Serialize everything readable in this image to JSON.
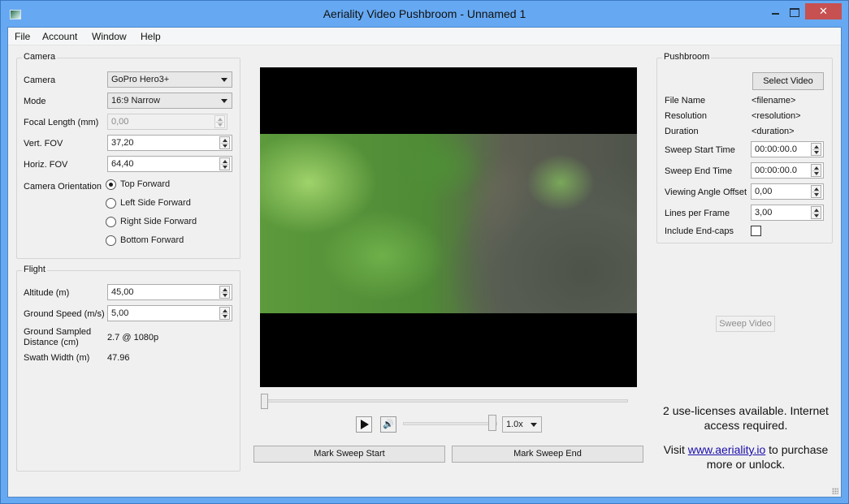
{
  "window": {
    "title": "Aeriality Video Pushbroom - Unnamed 1",
    "close_glyph": "✕",
    "icon": "app-icon"
  },
  "menu": [
    "File",
    "Account",
    "Window",
    "Help"
  ],
  "camera": {
    "group_title": "Camera",
    "camera_label": "Camera",
    "camera_value": "GoPro Hero3+",
    "mode_label": "Mode",
    "mode_value": "16:9 Narrow",
    "focal_label": "Focal Length (mm)",
    "focal_value": "0,00",
    "vfov_label": "Vert. FOV",
    "vfov_value": "37,20",
    "hfov_label": "Horiz. FOV",
    "hfov_value": "64,40",
    "orientation_label": "Camera Orientation",
    "orientations": [
      {
        "label": "Top Forward",
        "checked": true
      },
      {
        "label": "Left Side Forward",
        "checked": false
      },
      {
        "label": "Right Side Forward",
        "checked": false
      },
      {
        "label": "Bottom Forward",
        "checked": false
      }
    ]
  },
  "flight": {
    "group_title": "Flight",
    "altitude_label": "Altitude (m)",
    "altitude_value": "45,00",
    "speed_label": "Ground Speed (m/s)",
    "speed_value": "5,00",
    "gsd_label_1": "Ground Sampled",
    "gsd_label_2": "Distance (cm)",
    "gsd_value": "2.7 @ 1080p",
    "swath_label": "Swath Width (m)",
    "swath_value": "47.96"
  },
  "player": {
    "seek_position": 0,
    "volume": 1.0,
    "mute_glyph": "🔊",
    "rate_value": "1.0x",
    "mark_start_label": "Mark Sweep Start",
    "mark_end_label": "Mark Sweep End"
  },
  "pushbroom": {
    "group_title": "Pushbroom",
    "select_video_label": "Select Video",
    "file_name_label": "File Name",
    "file_name_value": "<filename>",
    "resolution_label": "Resolution",
    "resolution_value": "<resolution>",
    "duration_label": "Duration",
    "duration_value": "<duration>",
    "sweep_start_label": "Sweep Start Time",
    "sweep_start_value": "00:00:00.0",
    "sweep_end_label": "Sweep End Time",
    "sweep_end_value": "00:00:00.0",
    "angle_offset_label": "Viewing Angle Offset",
    "angle_offset_value": "0,00",
    "lines_label": "Lines per Frame",
    "lines_value": "3,00",
    "endcaps_label": "Include End-caps",
    "endcaps_checked": false,
    "sweep_video_label": "Sweep Video"
  },
  "license": {
    "line1": "2 use-licenses available. Internet access required.",
    "visit_prefix": "Visit ",
    "link_text": "www.aeriality.io",
    "visit_suffix": " to purchase more or unlock."
  }
}
